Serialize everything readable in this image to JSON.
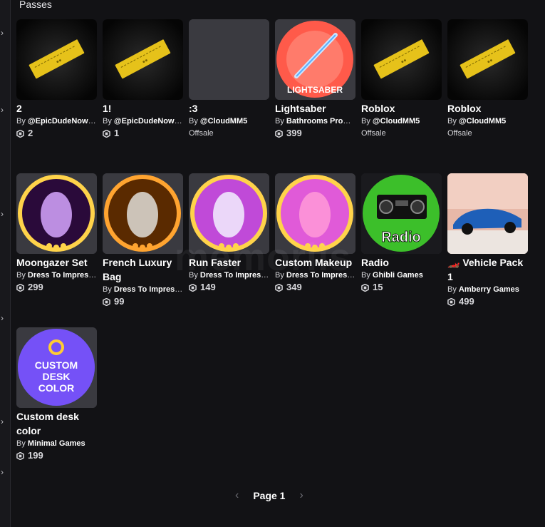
{
  "section_title": "Passes",
  "passes": [
    {
      "name": "2",
      "creator": "@EpicDudeNow1...",
      "price": "2",
      "thumb": "ticket"
    },
    {
      "name": "1!",
      "creator": "@EpicDudeNow1...",
      "price": "1",
      "thumb": "ticket"
    },
    {
      "name": ":3",
      "creator": "@CloudMM5",
      "offsale": "Offsale",
      "thumb": "blank"
    },
    {
      "name": "Lightsaber",
      "creator": "Bathrooms Produ...",
      "price": "399",
      "thumb": "lightsaber",
      "thumb_text": "LIGHTSABER"
    },
    {
      "name": "Roblox",
      "creator": "@CloudMM5",
      "offsale": "Offsale",
      "thumb": "ticket"
    },
    {
      "name": "Roblox",
      "creator": "@CloudMM5",
      "offsale": "Offsale",
      "thumb": "ticket"
    },
    {
      "name": "Moongazer Set",
      "creator": "Dress To Impress ...",
      "price": "299",
      "thumb": "moongazer"
    },
    {
      "name": "French Luxury Bag",
      "creator": "Dress To Impress ...",
      "price": "99",
      "thumb": "bag"
    },
    {
      "name": "Run Faster",
      "creator": "Dress To Impress ...",
      "price": "149",
      "thumb": "heel"
    },
    {
      "name": "Custom Makeup",
      "creator": "Dress To Impress ...",
      "price": "349",
      "thumb": "makeup"
    },
    {
      "name": "Radio",
      "creator": "Ghibli Games",
      "price": "15",
      "thumb": "radio",
      "thumb_text": "Radio"
    },
    {
      "name": "🏎️ Vehicle Pack 1",
      "creator": "Amberry Games",
      "price": "499",
      "thumb": "car"
    },
    {
      "name": "Custom desk color",
      "creator": "Minimal Games",
      "price": "199",
      "thumb": "desk",
      "thumb_text": "CUSTOM DESK COLOR"
    }
  ],
  "by_label": "By",
  "pager": {
    "label": "Page 1",
    "prev": "‹",
    "next": "›"
  },
  "watermark": "memoriis",
  "colors": {
    "bg": "#121215",
    "ticket": "#e6c21a",
    "card_bg": "#2b2b30"
  },
  "rail_icons": [
    "chevron-right-icon",
    "chevron-right-icon",
    "chevron-right-icon",
    "chevron-right-icon",
    "chevron-right-icon",
    "chevron-right-icon"
  ]
}
